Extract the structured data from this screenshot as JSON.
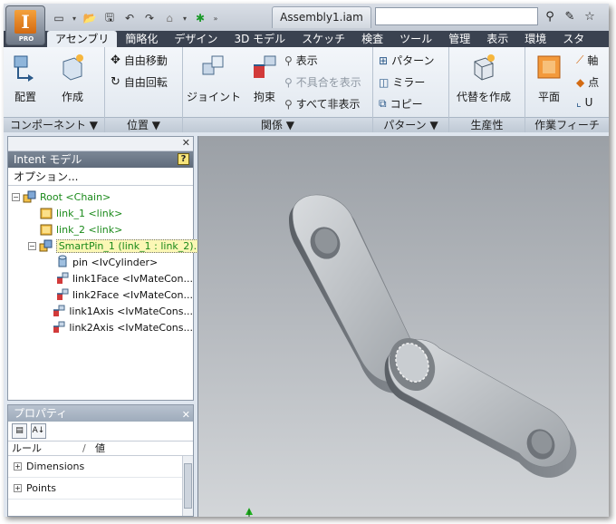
{
  "titlebar": {
    "app_logo_letter": "I",
    "app_edition": "PRO",
    "document_tab": "Assembly1.iam",
    "search_value": ""
  },
  "ribbon_tabs": [
    "アセンブリ",
    "簡略化",
    "デザイン",
    "3D モデル",
    "スケッチ",
    "検査",
    "ツール",
    "管理",
    "表示",
    "環境",
    "スタ"
  ],
  "ribbon": {
    "component": {
      "title": "コンポーネント ▼",
      "place": "配置",
      "create": "作成"
    },
    "position": {
      "title": "位置 ▼",
      "free_move": "自由移動",
      "free_rotate": "自由回転"
    },
    "relationships": {
      "title": "関係 ▼",
      "joint": "ジョイント",
      "constrain": "拘束",
      "show": "表示",
      "show_sick": "不具合を表示",
      "hide_all": "すべて非表示"
    },
    "pattern": {
      "title": "パターン ▼",
      "pattern": "パターン",
      "mirror": "ミラー",
      "copy": "コピー"
    },
    "productivity": {
      "title": "生産性",
      "substitute": "代替を作成"
    },
    "work_features": {
      "title": "作業フィーチ",
      "plane": "平面",
      "axis": "軸",
      "point": "点",
      "ucs": "U"
    }
  },
  "browser": {
    "title": "Intent モデル",
    "help": "?",
    "options": "オプション...",
    "tree": [
      {
        "label": "Root <Chain>",
        "color": "green",
        "level": 0,
        "expander": "⊟",
        "icon": "assembly-icon"
      },
      {
        "label": "link_1 <link>",
        "color": "green",
        "level": 1,
        "expander": "",
        "icon": "part-icon"
      },
      {
        "label": "link_2 <link>",
        "color": "green",
        "level": 1,
        "expander": "",
        "icon": "part-icon"
      },
      {
        "label": "SmartPin_1 (link_1 : link_2)...",
        "color": "green",
        "level": 1,
        "expander": "⊟",
        "icon": "assembly-icon",
        "selected": true
      },
      {
        "label": "pin <IvCylinder>",
        "color": "black",
        "level": 2,
        "expander": "",
        "icon": "cylinder-icon"
      },
      {
        "label": "link1Face <IvMateCon...",
        "color": "black",
        "level": 2,
        "expander": "",
        "icon": "mate-icon"
      },
      {
        "label": "link2Face <IvMateCon...",
        "color": "black",
        "level": 2,
        "expander": "",
        "icon": "mate-icon"
      },
      {
        "label": "link1Axis <IvMateCons...",
        "color": "black",
        "level": 2,
        "expander": "",
        "icon": "mate-icon"
      },
      {
        "label": "link2Axis <IvMateCons...",
        "color": "black",
        "level": 2,
        "expander": "",
        "icon": "mate-icon"
      }
    ]
  },
  "properties": {
    "title": "プロパティ",
    "col_rule": "ルール",
    "col_sep": "/",
    "col_value": "値",
    "rows": [
      "Dimensions",
      "Points"
    ]
  }
}
